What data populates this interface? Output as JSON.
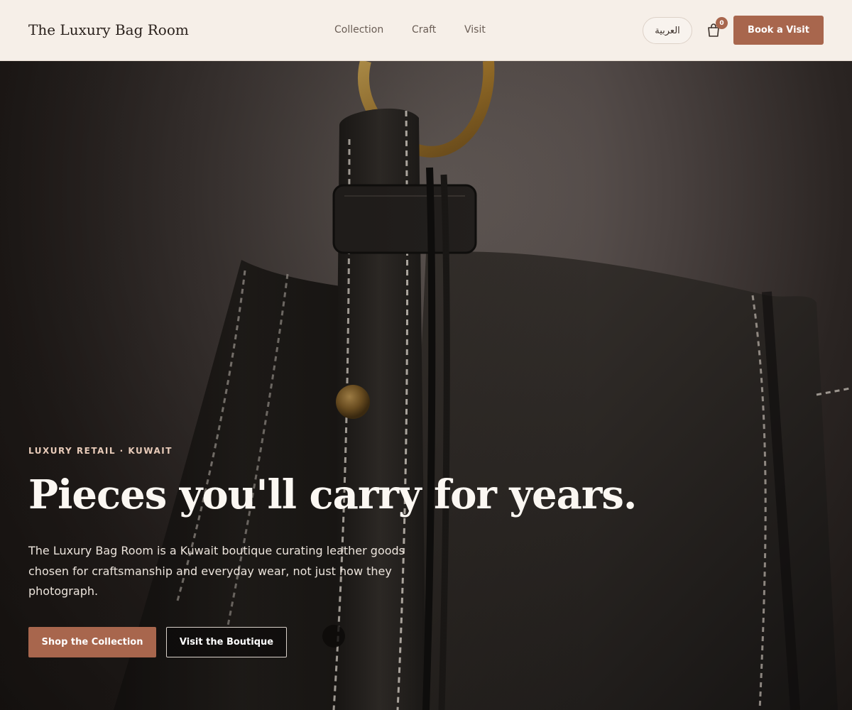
{
  "header": {
    "brand": "The Luxury Bag Room",
    "nav": [
      "Collection",
      "Craft",
      "Visit"
    ],
    "language_toggle": "العربية",
    "cart_count": "0",
    "cta": "Book a Visit"
  },
  "hero": {
    "eyebrow": "LUXURY RETAIL · KUWAIT",
    "headline": "Pieces you'll carry for years.",
    "lede": "The Luxury Bag Room is a Kuwait boutique curating leather goods chosen for craftsmanship and everyday wear, not just how they photograph.",
    "primary_button": "Shop the Collection",
    "secondary_button": "Visit the Boutique"
  },
  "colors": {
    "accent": "#a8664d",
    "header_bg": "#f6efe8",
    "eyebrow": "#e8cbb9"
  },
  "icons": {
    "cart": "shopping-bag-icon"
  }
}
